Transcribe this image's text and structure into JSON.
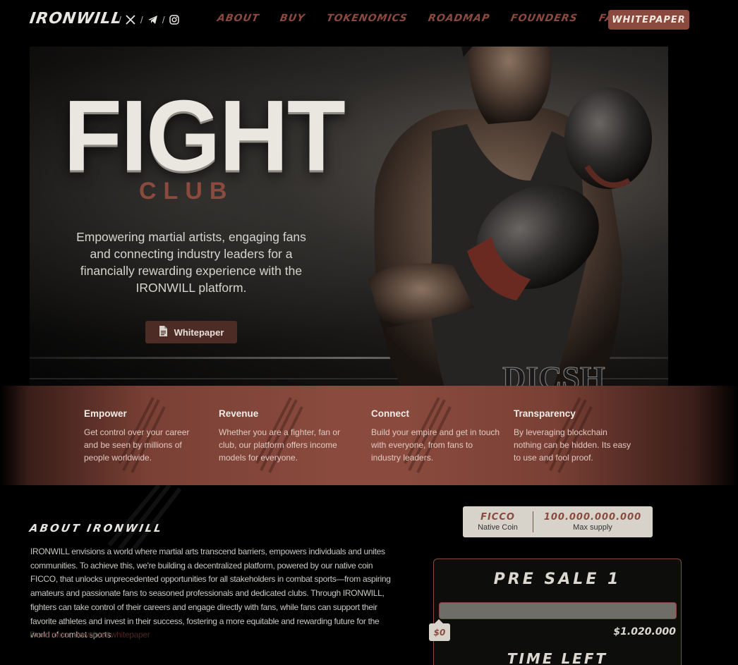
{
  "nav": {
    "logo": "IRONWILL",
    "socials": [
      "x-icon",
      "telegram-icon",
      "instagram-icon"
    ],
    "menu": [
      "ABOUT",
      "BUY",
      "TOKENOMICS",
      "ROADMAP",
      "FOUNDERS",
      "FAQ"
    ],
    "cta": "WHITEPAPER"
  },
  "hero": {
    "headline": "FIGHT",
    "subheadline": "CLUB",
    "tagline": "Empowering martial artists, engaging fans and connecting industry leaders for a financially rewarding experience with the IRONWILL platform.",
    "button_label": "Whitepaper",
    "button_icon": "document-icon",
    "shorts_text": "DICSH"
  },
  "features": [
    {
      "title": "Empower",
      "text": "Get control over your career and be seen by millions of people worldwide."
    },
    {
      "title": "Revenue",
      "text": "Whether you are a fighter, fan or club, our platform offers income models for everyone."
    },
    {
      "title": "Connect",
      "text": "Build your empire and get in touch with everyone, from fans to industry leaders."
    },
    {
      "title": "Transparency",
      "text": "By leveraging blockchain nothing can be hidden. Its easy to use and fool proof."
    }
  ],
  "about": {
    "title": "ABOUT IRONWILL",
    "body": "IRONWILL envisions a world where martial arts transcend barriers, empowers individuals and unites communities. To achieve this, we're building a decentralized platform, powered by our native coin FICCO, that unlocks unprecedented opportunities for all stakeholders in combat sports—from aspiring amateurs and passionate fans to seasoned professionals and dedicated clubs. Through IRONWILL, fighters can take control of their careers and engage directly with fans, while fans can support their favorite athletes and invest in their success, fostering a more equitable and rewarding future for the world of combat sports.",
    "read_more": "Read more, download whitepaper"
  },
  "coin": {
    "name": "FICCO",
    "name_label": "Native Coin",
    "supply": "100.000.000.000",
    "supply_label": "Max supply"
  },
  "presale": {
    "title": "PRE SALE 1",
    "progress": 0,
    "raised": "$0",
    "goal": "$1.020.000",
    "time_title": "TIME LEFT"
  },
  "colors": {
    "accent": "#8a4a3e",
    "background": "#000000",
    "light": "#d7d3cb"
  }
}
